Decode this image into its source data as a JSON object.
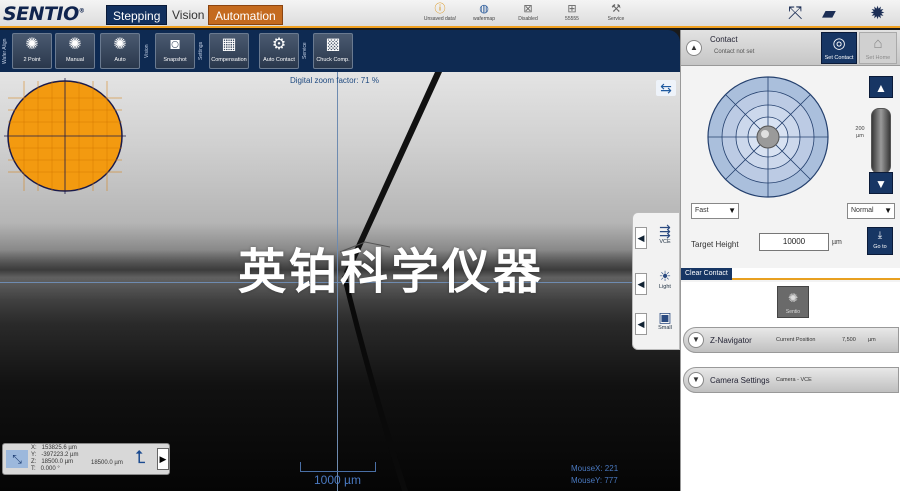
{
  "app": {
    "logo": "SENTIO",
    "logo_mark": "®",
    "tabs": [
      "Stepping",
      "Vision",
      "Automation"
    ]
  },
  "status": {
    "unsaved": "Unsaved data!",
    "wafermap": "wafermap",
    "disabled": "Disabled",
    "id": "55555",
    "service": "Service"
  },
  "toolbar": {
    "group_wafer_align": "Wafer Align",
    "group_vision": "Vision",
    "group_settings": "Settings",
    "group_service": "Service",
    "btn_2point": "2 Point",
    "btn_manual": "Manual",
    "btn_auto": "Auto",
    "btn_snapshot": "Snapshot",
    "btn_compensation": "Compensation",
    "btn_autocontact": "Auto Contact",
    "btn_chuckcomp": "Chuck Comp."
  },
  "view": {
    "zoom_text": "Digital zoom factor: 71 %",
    "watermark": "英铂科学仪器",
    "scale_label": "1000 µm",
    "mouse_x": "MouseX: 221",
    "mouse_y": "MouseY: 777",
    "coords": "X:   153825.6 µm\nY:   -397223.2 µm\nZ:   18500.0 µm\nT:   0.000 °",
    "coords_extra": "18500.0 µm"
  },
  "side_tools": {
    "vce": "VCE",
    "light": "Light",
    "small": "Small"
  },
  "contact": {
    "title": "Contact",
    "subtitle": "Contact not set",
    "set_contact": "Set Contact",
    "set_home": "Set Home",
    "speed": "Fast",
    "mode": "Normal",
    "z_range": "200 µm",
    "target_label": "Target Height",
    "target_value": "10000",
    "target_unit": "µm",
    "goto": "Go to",
    "clear_contact": "Clear Contact"
  },
  "lower": {
    "small_btn": "Sentio",
    "znav_title": "Z-Navigator",
    "znav_pos_label": "Current Position",
    "znav_pos_value": "7,500",
    "znav_unit": "µm",
    "camera_title": "Camera Settings",
    "camera_sub": "Camera - VCE"
  }
}
